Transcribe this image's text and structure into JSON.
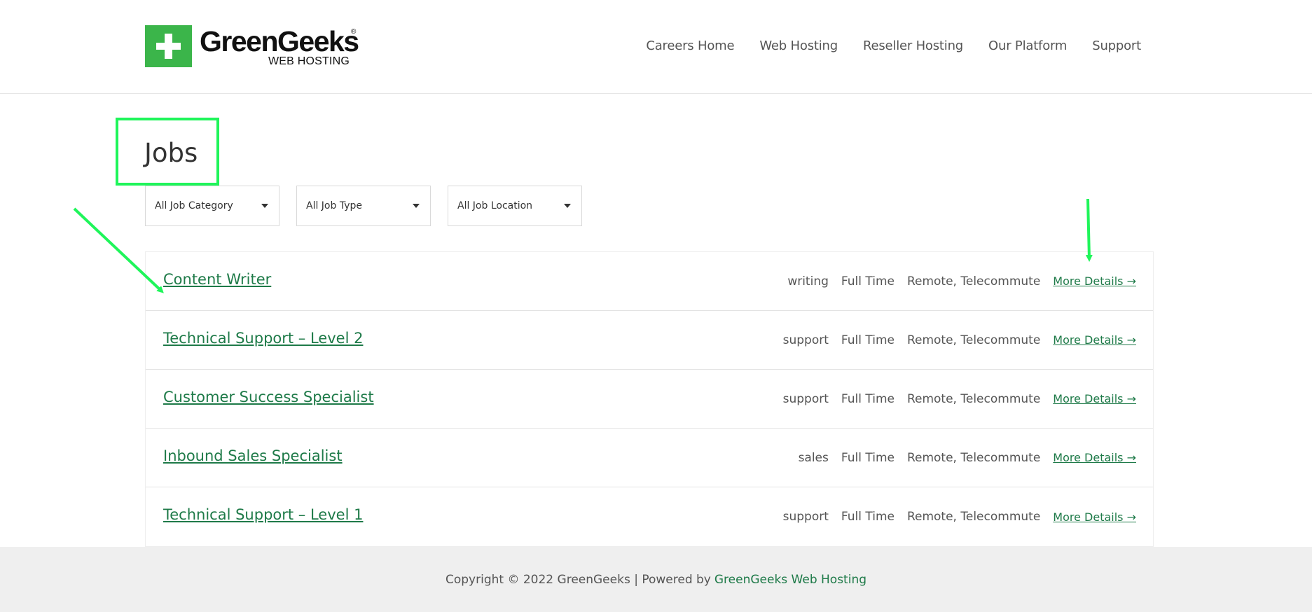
{
  "logo": {
    "name": "GreenGeeks",
    "registered": "®",
    "sub": "WEB HOSTING",
    "brand_color": "#3bb54a"
  },
  "nav": [
    "Careers Home",
    "Web Hosting",
    "Reseller Hosting",
    "Our Platform",
    "Support"
  ],
  "page_title": "Jobs",
  "filters": [
    {
      "label": "All Job Category"
    },
    {
      "label": "All Job Type"
    },
    {
      "label": "All Job Location"
    }
  ],
  "jobs": [
    {
      "title": "Content Writer",
      "category": "writing",
      "type": "Full Time",
      "location": "Remote, Telecommute",
      "link": "More Details →"
    },
    {
      "title": "Technical Support – Level 2",
      "category": "support",
      "type": "Full Time",
      "location": "Remote, Telecommute",
      "link": "More Details →"
    },
    {
      "title": "Customer Success Specialist",
      "category": "support",
      "type": "Full Time",
      "location": "Remote, Telecommute",
      "link": "More Details →"
    },
    {
      "title": "Inbound Sales Specialist",
      "category": "sales",
      "type": "Full Time",
      "location": "Remote, Telecommute",
      "link": "More Details →"
    },
    {
      "title": "Technical Support – Level 1",
      "category": "support",
      "type": "Full Time",
      "location": "Remote, Telecommute",
      "link": "More Details →"
    }
  ],
  "footer": {
    "text": "Copyright © 2022 GreenGeeks | Powered by",
    "link": "GreenGeeks Web Hosting"
  },
  "colors": {
    "accent": "#1e7a48",
    "annotation": "#1ff55a"
  }
}
